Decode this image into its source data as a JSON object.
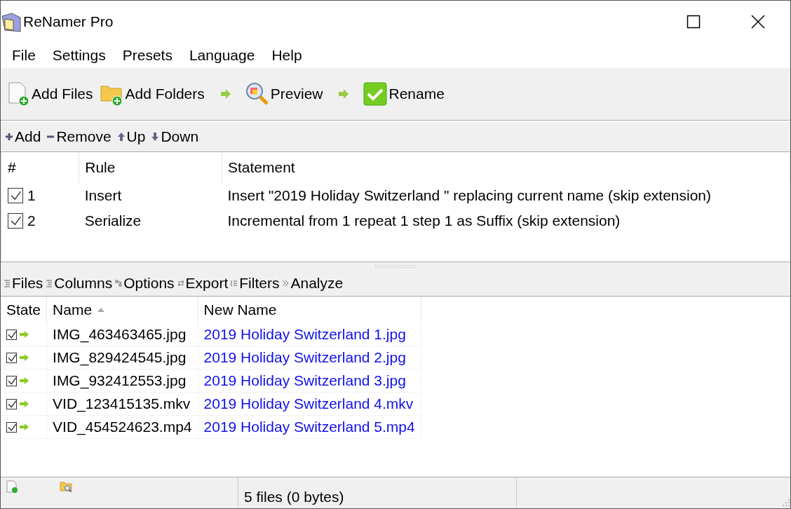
{
  "window": {
    "title": "ReNamer Pro"
  },
  "menu": [
    "File",
    "Settings",
    "Presets",
    "Language",
    "Help"
  ],
  "toolbar": [
    {
      "kind": "add-file",
      "label": "Add Files"
    },
    {
      "kind": "add-folder",
      "label": "Add Folders"
    },
    {
      "kind": "arrow"
    },
    {
      "kind": "preview",
      "label": "Preview"
    },
    {
      "kind": "arrow"
    },
    {
      "kind": "rename",
      "label": "Rename"
    }
  ],
  "rules_toolbar": [
    {
      "kind": "plus",
      "label": "Add"
    },
    {
      "kind": "minus",
      "label": "Remove"
    },
    {
      "kind": "up",
      "label": "Up"
    },
    {
      "kind": "down",
      "label": "Down"
    }
  ],
  "rules_table": {
    "columns": [
      "#",
      "Rule",
      "Statement"
    ],
    "rows": [
      {
        "checked": true,
        "number": "1",
        "rule": "Insert",
        "statement": "Insert \"2019 Holiday Switzerland \" replacing current name (skip extension)"
      },
      {
        "checked": true,
        "number": "2",
        "rule": "Serialize",
        "statement": "Incremental from 1 repeat 1 step 1 as Suffix (skip extension)"
      }
    ]
  },
  "files_toolbar": [
    {
      "kind": "list",
      "label": "Files"
    },
    {
      "kind": "list",
      "label": "Columns"
    },
    {
      "kind": "options",
      "label": "Options"
    },
    {
      "kind": "export",
      "label": "Export"
    },
    {
      "kind": "filter",
      "label": "Filters"
    },
    {
      "kind": "analyze",
      "label": "Analyze"
    }
  ],
  "files_table": {
    "columns": [
      "State",
      "Name",
      "New Name"
    ],
    "rows": [
      {
        "checked": true,
        "name": "IMG_463463465.jpg",
        "new_name": "2019 Holiday Switzerland 1.jpg"
      },
      {
        "checked": true,
        "name": "IMG_829424545.jpg",
        "new_name": "2019 Holiday Switzerland 2.jpg"
      },
      {
        "checked": true,
        "name": "IMG_932412553.jpg",
        "new_name": "2019 Holiday Switzerland 3.jpg"
      },
      {
        "checked": true,
        "name": "VID_123415135.mkv",
        "new_name": "2019 Holiday Switzerland 4.mkv"
      },
      {
        "checked": true,
        "name": "VID_454524623.mp4",
        "new_name": "2019 Holiday Switzerland 5.mp4"
      }
    ]
  },
  "status_bar": {
    "text": "5 files (0 bytes)"
  }
}
